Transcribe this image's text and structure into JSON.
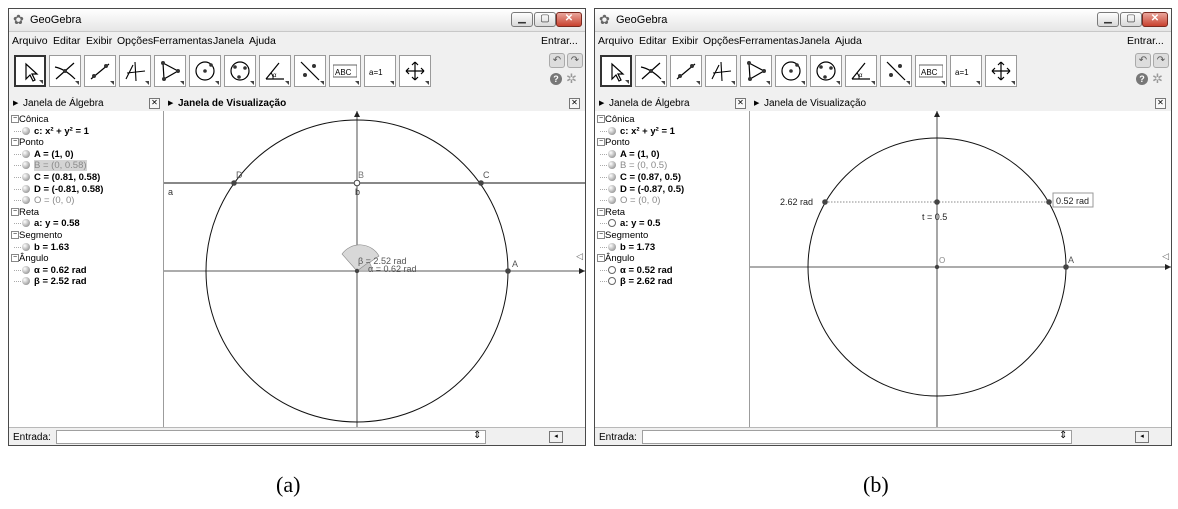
{
  "window_title": "GeoGebra",
  "menu": [
    "Arquivo",
    "Editar",
    "Exibir",
    "Opções",
    "Ferramentas",
    "Janela",
    "Ajuda"
  ],
  "login_label": "Entrar...",
  "tool_text": {
    "abc": "ABC",
    "slider": "a=1"
  },
  "algebra_title": "Janela de Álgebra",
  "graphics_title": "Janela de Visualização",
  "input_label": "Entrada:",
  "colors": {
    "accent_selection": "#d4d4d4",
    "close_button": "#c8412e",
    "angle_fill": "#d8d8d8"
  },
  "panels": {
    "a": {
      "caption": "(a)",
      "algebra": [
        {
          "kind": "group",
          "text": "Cônica"
        },
        {
          "kind": "item",
          "text": "c: x² + y² = 1",
          "style": "bold",
          "dot": "filled"
        },
        {
          "kind": "group",
          "text": "Ponto"
        },
        {
          "kind": "item",
          "text": "A = (1, 0)",
          "style": "bold",
          "dot": "filled"
        },
        {
          "kind": "item",
          "text": "B = (0, 0.58)",
          "style": "gray-highlight",
          "dot": "filled"
        },
        {
          "kind": "item",
          "text": "C = (0.81, 0.58)",
          "style": "bold",
          "dot": "filled"
        },
        {
          "kind": "item",
          "text": "D = (-0.81, 0.58)",
          "style": "bold",
          "dot": "filled"
        },
        {
          "kind": "item",
          "text": "O = (0, 0)",
          "style": "gray",
          "dot": "filled"
        },
        {
          "kind": "group",
          "text": "Reta"
        },
        {
          "kind": "item",
          "text": "a: y = 0.58",
          "style": "bold",
          "dot": "filled"
        },
        {
          "kind": "group",
          "text": "Segmento"
        },
        {
          "kind": "item",
          "text": "b = 1.63",
          "style": "bold",
          "dot": "filled"
        },
        {
          "kind": "group",
          "text": "Ângulo"
        },
        {
          "kind": "item",
          "text": "α = 0.62 rad",
          "style": "bold",
          "dot": "filled"
        },
        {
          "kind": "item",
          "text": "β = 2.52 rad",
          "style": "bold",
          "dot": "filled"
        }
      ],
      "labels": {
        "D": "D",
        "B": "B",
        "C": "C",
        "A": "A",
        "a": "a",
        "b": "b",
        "beta": "β = 2.52 rad",
        "alpha": "α = 0.62 rad"
      }
    },
    "b": {
      "caption": "(b)",
      "algebra": [
        {
          "kind": "group",
          "text": "Cônica"
        },
        {
          "kind": "item",
          "text": "c: x² + y² = 1",
          "style": "bold",
          "dot": "filled"
        },
        {
          "kind": "group",
          "text": "Ponto"
        },
        {
          "kind": "item",
          "text": "A = (1, 0)",
          "style": "bold",
          "dot": "filled"
        },
        {
          "kind": "item",
          "text": "B = (0, 0.5)",
          "style": "gray",
          "dot": "filled"
        },
        {
          "kind": "item",
          "text": "C = (0.87, 0.5)",
          "style": "bold",
          "dot": "filled"
        },
        {
          "kind": "item",
          "text": "D = (-0.87, 0.5)",
          "style": "bold",
          "dot": "filled"
        },
        {
          "kind": "item",
          "text": "O = (0, 0)",
          "style": "gray",
          "dot": "filled"
        },
        {
          "kind": "group",
          "text": "Reta"
        },
        {
          "kind": "item",
          "text": "a: y = 0.5",
          "style": "bold",
          "dot": "empty"
        },
        {
          "kind": "group",
          "text": "Segmento"
        },
        {
          "kind": "item",
          "text": "b = 1.73",
          "style": "bold",
          "dot": "filled"
        },
        {
          "kind": "group",
          "text": "Ângulo"
        },
        {
          "kind": "item",
          "text": "α = 0.52 rad",
          "style": "bold",
          "dot": "empty"
        },
        {
          "kind": "item",
          "text": "β = 2.62 rad",
          "style": "bold",
          "dot": "empty"
        }
      ],
      "labels": {
        "left": "2.62 rad",
        "right": "0.52 rad",
        "t": "t = 0.5",
        "O": "O",
        "A": "A"
      }
    }
  }
}
